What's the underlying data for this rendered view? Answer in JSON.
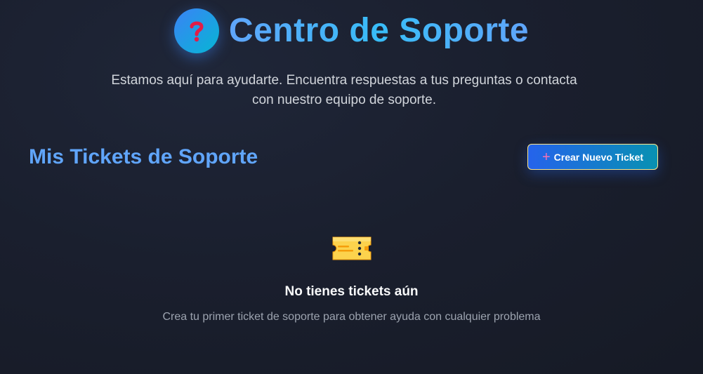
{
  "header": {
    "icon": "question-mark-icon",
    "title": "Centro de Soporte",
    "subtitle": "Estamos aquí para ayudarte. Encuentra respuestas a tus preguntas o contacta con nuestro equipo de soporte."
  },
  "tickets_section": {
    "title": "Mis Tickets de Soporte",
    "new_ticket_icon": "plus-icon",
    "new_ticket_label": "Crear Nuevo Ticket"
  },
  "empty_state": {
    "icon": "ticket-icon",
    "title": "No tienes tickets aún",
    "description": "Crea tu primer ticket de soporte para obtener ayuda con cualquier problema"
  },
  "colors": {
    "background": "#1a1f2e",
    "accent": "#60a5fa",
    "button_gradient_start": "#2563eb",
    "button_gradient_end": "#0891b2"
  }
}
